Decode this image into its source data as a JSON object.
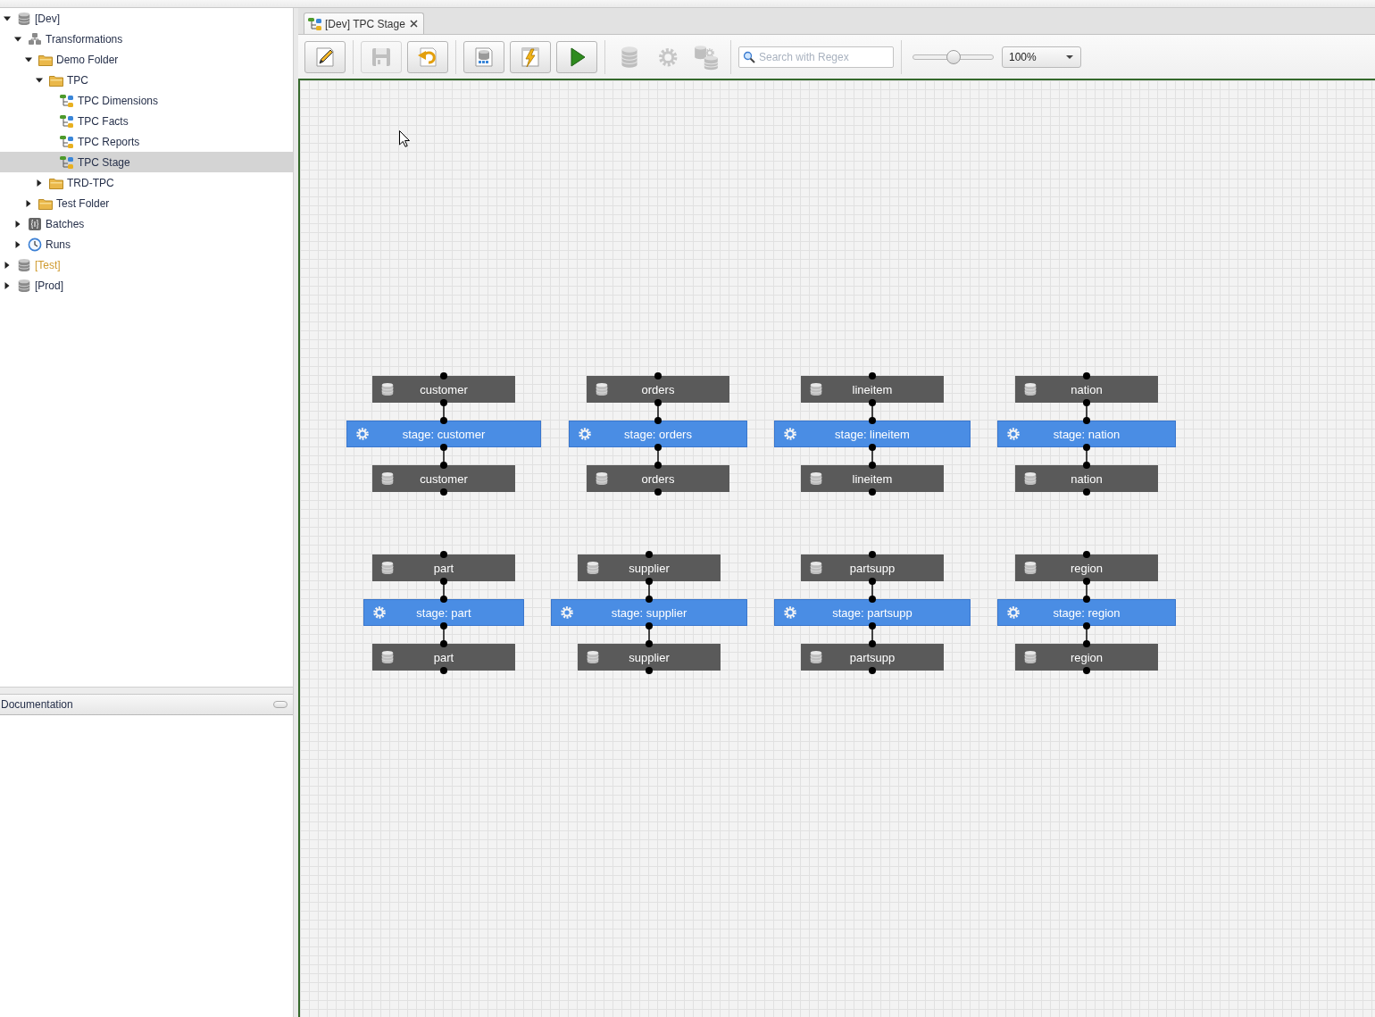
{
  "tree": [
    {
      "label": "[Dev]",
      "kind": "database",
      "color": "#26304a",
      "expanded": true,
      "selected": false,
      "children": [
        {
          "label": "Transformations",
          "kind": "transformations",
          "expanded": true,
          "selected": false,
          "children": [
            {
              "label": "Demo Folder",
              "kind": "folder",
              "expanded": true,
              "selected": false,
              "children": [
                {
                  "label": "TPC",
                  "kind": "folder",
                  "expanded": true,
                  "selected": false,
                  "children": [
                    {
                      "label": "TPC Dimensions",
                      "kind": "pipeline",
                      "selected": false
                    },
                    {
                      "label": "TPC Facts",
                      "kind": "pipeline",
                      "selected": false
                    },
                    {
                      "label": "TPC Reports",
                      "kind": "pipeline",
                      "selected": false
                    },
                    {
                      "label": "TPC Stage",
                      "kind": "pipeline",
                      "selected": true
                    }
                  ]
                },
                {
                  "label": "TRD-TPC",
                  "kind": "folder",
                  "expanded": false,
                  "selected": false
                }
              ]
            },
            {
              "label": "Test Folder",
              "kind": "folder",
              "expanded": false,
              "selected": false
            }
          ]
        },
        {
          "label": "Batches",
          "kind": "batches",
          "expanded": false,
          "selected": false
        },
        {
          "label": "Runs",
          "kind": "runs",
          "expanded": false,
          "selected": false
        }
      ]
    },
    {
      "label": "[Test]",
      "kind": "database",
      "color": "#cf9a2e",
      "expanded": false,
      "selected": false
    },
    {
      "label": "[Prod]",
      "kind": "database",
      "color": "#26304a",
      "expanded": false,
      "selected": false
    }
  ],
  "documentation": {
    "title": "Documentation"
  },
  "tabs": [
    {
      "label": "[Dev] TPC Stage",
      "selected": true
    }
  ],
  "toolbar": {
    "groups": [
      {
        "kind": "framed",
        "buttons": [
          {
            "kind": "edit",
            "disabled": false
          }
        ]
      },
      {
        "kind": "framed",
        "buttons": [
          {
            "kind": "save",
            "disabled": true
          },
          {
            "kind": "undo",
            "disabled": false
          }
        ]
      },
      {
        "kind": "framed",
        "buttons": [
          {
            "kind": "sql",
            "disabled": false
          },
          {
            "kind": "execute",
            "disabled": false
          },
          {
            "kind": "run",
            "disabled": false
          }
        ]
      },
      {
        "kind": "bare",
        "buttons": [
          {
            "kind": "database",
            "disabled": true
          },
          {
            "kind": "settings",
            "disabled": true
          },
          {
            "kind": "databases",
            "disabled": true
          }
        ]
      }
    ],
    "search": {
      "placeholder": "Search with Regex"
    },
    "zoom_slider": {
      "level": 0.5
    },
    "zoom_select": {
      "value": "100%"
    }
  },
  "canvas": {
    "flows": [
      {
        "source": "customer",
        "stage": "stage: customer",
        "target": "customer"
      },
      {
        "source": "orders",
        "stage": "stage: orders",
        "target": "orders"
      },
      {
        "source": "lineitem",
        "stage": "stage: lineitem",
        "target": "lineitem"
      },
      {
        "source": "nation",
        "stage": "stage: nation",
        "target": "nation"
      },
      {
        "source": "part",
        "stage": "stage: part",
        "target": "part"
      },
      {
        "source": "supplier",
        "stage": "stage: supplier",
        "target": "supplier"
      },
      {
        "source": "partsupp",
        "stage": "stage: partsupp",
        "target": "partsupp"
      },
      {
        "source": "region",
        "stage": "stage: region",
        "target": "region"
      }
    ]
  }
}
